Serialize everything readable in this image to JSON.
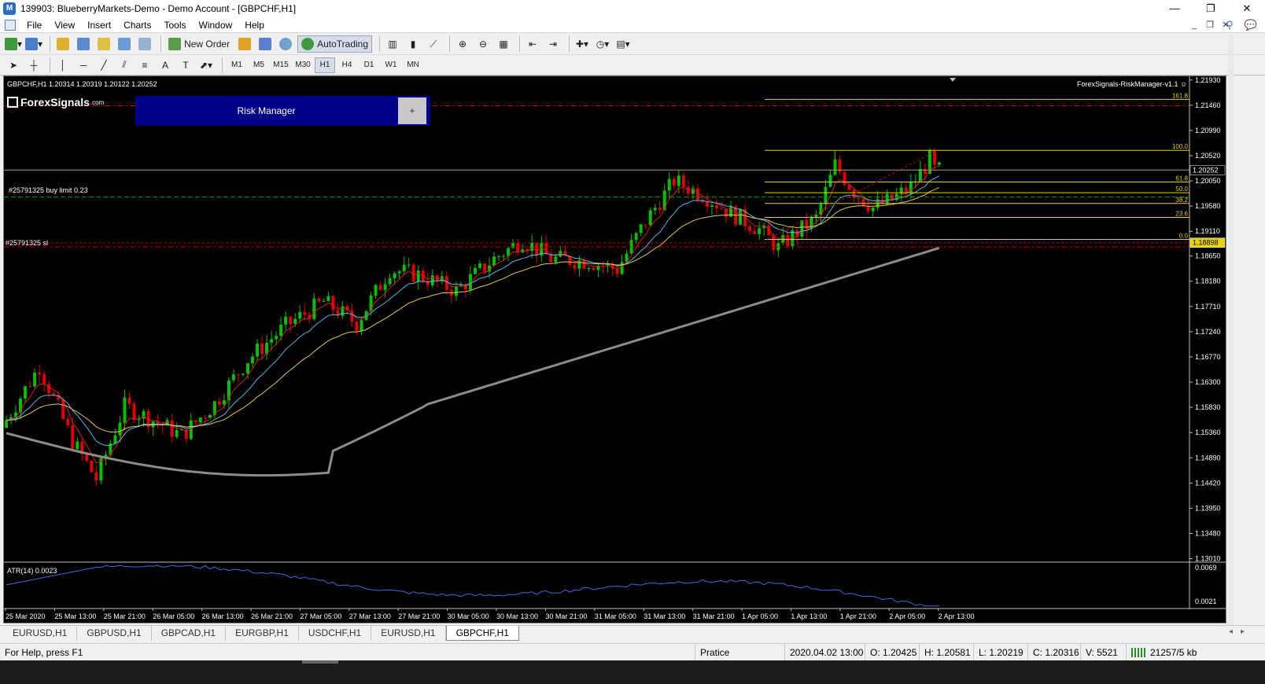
{
  "window": {
    "title": "139903: BlueberryMarkets-Demo - Demo Account - [GBPCHF,H1]",
    "controls": [
      "—",
      "❐",
      "✕"
    ]
  },
  "menu": [
    "File",
    "View",
    "Insert",
    "Charts",
    "Tools",
    "Window",
    "Help"
  ],
  "toolbar": {
    "new_order": "New Order",
    "autotrading": "AutoTrading"
  },
  "timeframes": [
    "M1",
    "M5",
    "M15",
    "M30",
    "H1",
    "H4",
    "D1",
    "W1",
    "MN"
  ],
  "active_timeframe": "H1",
  "chart": {
    "header": "GBPCHF,H1  1.20314 1.20319 1.20122 1.20252",
    "ea_label": "ForexSignals-RiskManager-v1.1 ☺",
    "logo_text": "ForexSignals",
    "logo_suffix": ".com",
    "risk_manager_label": "Risk Manager",
    "risk_manager_plus": "+",
    "order_label": "#25791325 buy limit 0.23",
    "sl_label": "#25791325 sl",
    "current_price": "1.20252",
    "sl_price": "1.18898",
    "indicator_label": "ATR(14) 0.0023",
    "indicator_axis": [
      "0.0069",
      "0.0021"
    ],
    "price_axis": [
      "1.21930",
      "1.21460",
      "1.20990",
      "1.20520",
      "1.20050",
      "1.19580",
      "1.19110",
      "1.18650",
      "1.18180",
      "1.17710",
      "1.17240",
      "1.16770",
      "1.16300",
      "1.15830",
      "1.15360",
      "1.14890",
      "1.14420",
      "1.13950",
      "1.13480",
      "1.13010"
    ],
    "time_axis": [
      "25 Mar 2020",
      "25 Mar 13:00",
      "25 Mar 21:00",
      "26 Mar 05:00",
      "26 Mar 13:00",
      "26 Mar 21:00",
      "27 Mar 05:00",
      "27 Mar 13:00",
      "27 Mar 21:00",
      "30 Mar 05:00",
      "30 Mar 13:00",
      "30 Mar 21:00",
      "31 Mar 05:00",
      "31 Mar 13:00",
      "31 Mar 21:00",
      "1 Apr 05:00",
      "1 Apr 13:00",
      "1 Apr 21:00",
      "2 Apr 05:00",
      "2 Apr 13:00"
    ],
    "fib_levels": [
      "161.8",
      "100.0",
      "61.8",
      "50.0",
      "38.2",
      "23.6",
      "0.0"
    ],
    "colors": {
      "background": "#000000",
      "bull": "#00c000",
      "bear": "#e00000",
      "fib": "#e6d200",
      "ema_fast": "#d02020",
      "ema_mid": "#5ab4e6",
      "ema_slow": "#e6c84a",
      "ma_long": "#8c8c8c",
      "atr": "#3a6be0",
      "risk_panel": "#00008b"
    }
  },
  "tabs": [
    "EURUSD,H1",
    "GBPUSD,H1",
    "GBPCAD,H1",
    "EURGBP,H1",
    "USDCHF,H1",
    "EURUSD,H1",
    "GBPCHF,H1"
  ],
  "active_tab": "GBPCHF,H1",
  "status": {
    "help": "For Help, press F1",
    "profile": "Pratice",
    "datetime": "2020.04.02 13:00",
    "open": "O: 1.20425",
    "high": "H: 1.20581",
    "low": "L: 1.20219",
    "close": "C: 1.20316",
    "volume": "V: 5521",
    "traffic": "21257/5 kb"
  }
}
